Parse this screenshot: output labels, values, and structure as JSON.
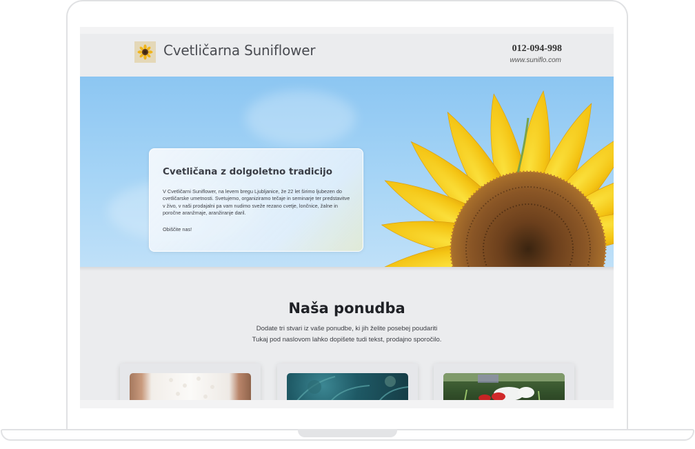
{
  "header": {
    "brand_name": "Cvetličarna Suniflower",
    "phone": "012-094-998",
    "website": "www.suniflo.com"
  },
  "hero": {
    "title": "Cvetličana z dolgoletno tradicijo",
    "text": "V Cvetličarni Suniflower, na levem bregu Ljubljanice, že 22 let širimo ljubezen do cvetličarske umetnosti. Svetujemo, organiziramo tečaje in seminarje ter predstavitve v živo, v naši prodajalni pa vam nudimo sveže rezano cvetje, lončnice, žalne in poročne aranžmaje, aranžiranje daril.",
    "cta": "Obiščite nas!"
  },
  "offer": {
    "title": "Naša ponudba",
    "subtitle_line1": "Dodate tri stvari iz vaše ponudbe, ki jih želite posebej poudariti",
    "subtitle_line2": "Tukaj pod naslovom lahko dopišete tudi tekst, prodajno sporočilo."
  },
  "colors": {
    "screen_bg": "#ebecee",
    "sky": "#8cc6f2",
    "petal": "#f6c615",
    "seed_center": "#6b3f1c"
  }
}
